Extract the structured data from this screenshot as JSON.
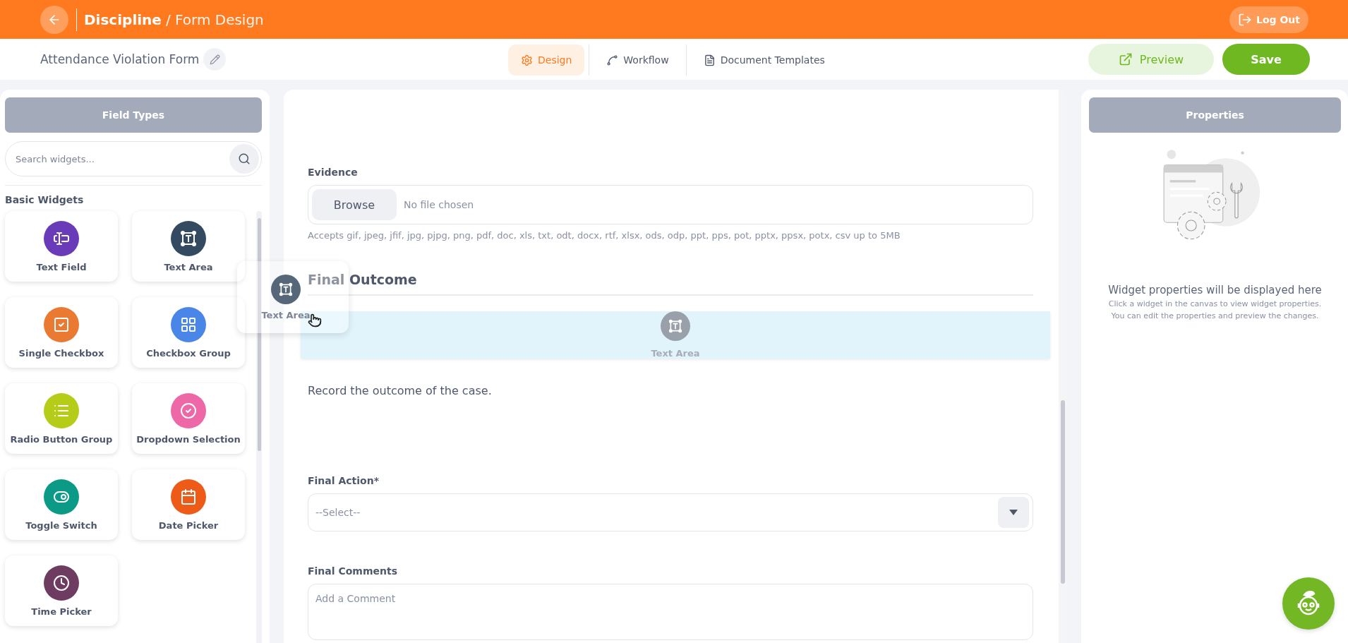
{
  "header": {
    "title_main": "Discipline",
    "title_sub": "/ Form Design",
    "logout": "Log Out"
  },
  "toolbar": {
    "form_name": "Attendance Violation Form",
    "tabs": [
      {
        "label": "Design",
        "selected": true
      },
      {
        "label": "Workflow",
        "selected": false
      },
      {
        "label": "Document Templates",
        "selected": false
      }
    ],
    "preview": "Preview",
    "save": "Save"
  },
  "field_types": {
    "title": "Field Types",
    "search_placeholder": "Search widgets...",
    "section": "Basic Widgets",
    "widgets": [
      {
        "label": "Text Field",
        "color": "#6a3bb8"
      },
      {
        "label": "Text Area",
        "color": "#344a61"
      },
      {
        "label": "Single Checkbox",
        "color": "#ea7a32"
      },
      {
        "label": "Checkbox Group",
        "color": "#4a86e8"
      },
      {
        "label": "Radio Button Group",
        "color": "#b5cc18"
      },
      {
        "label": "Dropdown Selection",
        "color": "#ee67a6"
      },
      {
        "label": "Toggle Switch",
        "color": "#0a9a86"
      },
      {
        "label": "Date Picker",
        "color": "#ee5b19"
      },
      {
        "label": "Time Picker",
        "color": "#6e3c61"
      }
    ]
  },
  "canvas": {
    "items": [
      {
        "kind": "file",
        "label": "Evidence",
        "button": "Browse",
        "value": "No file chosen",
        "hint": "Accepts gif, jpeg, jfif, jpg, pjpg, png, pdf, doc, xls, txt, odt, docx, rtf, xlsx, ods, odp, ppt, pps, pot, pptx, ppsx, potx, csv up to 5MB"
      },
      {
        "kind": "heading",
        "text": "Final Outcome"
      },
      {
        "kind": "dropzone",
        "label": "Text Area"
      },
      {
        "kind": "paragraph",
        "text": "Record the outcome of the case."
      },
      {
        "kind": "select",
        "label": "Final Action*",
        "placeholder": "--Select--"
      },
      {
        "kind": "textarea",
        "label": "Final Comments",
        "placeholder": "Add a Comment"
      }
    ]
  },
  "drag_ghost": {
    "label": "Text Area"
  },
  "properties": {
    "title": "Properties",
    "empty_title": "Widget properties will be displayed here",
    "empty_lines": [
      "Click a widget in the canvas to view widget properties.",
      "You can edit the properties and preview the changes."
    ]
  }
}
